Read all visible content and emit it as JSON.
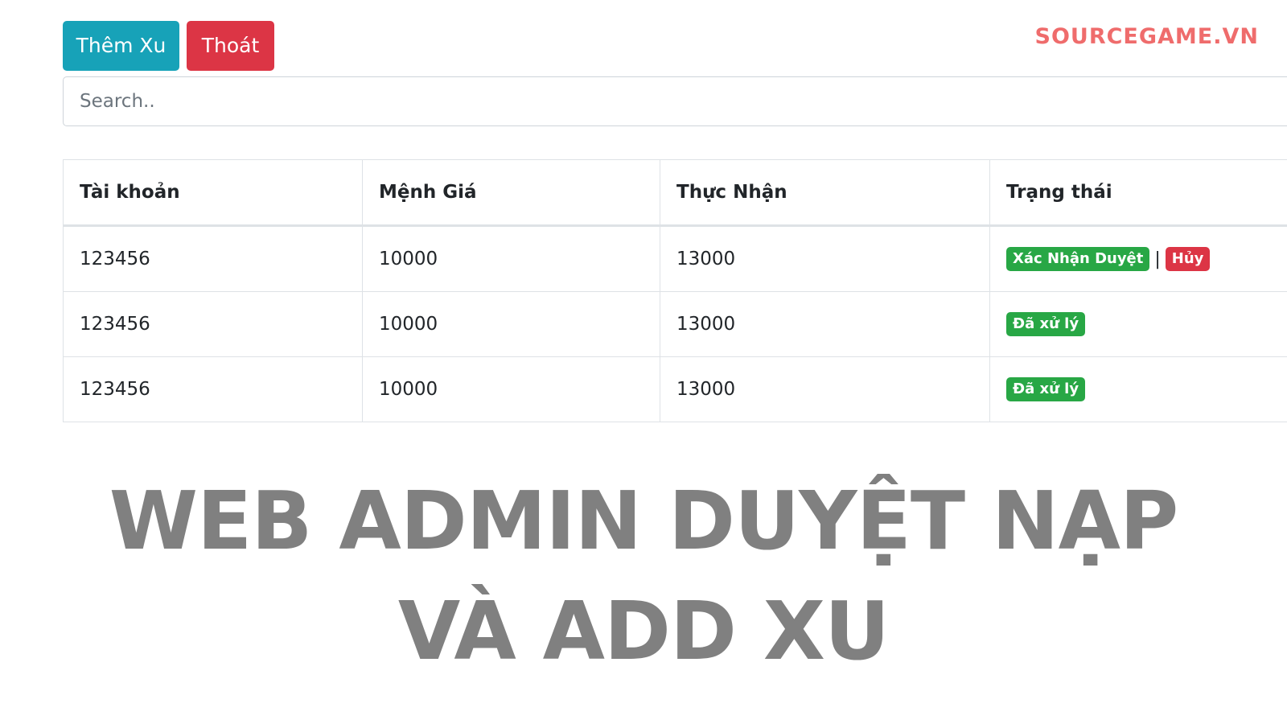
{
  "toolbar": {
    "add_label": "Thêm Xu",
    "exit_label": "Thoát"
  },
  "brand": "SOURCEGAME.VN",
  "search": {
    "placeholder": "Search.."
  },
  "table": {
    "headers": [
      "Tài khoản",
      "Mệnh Giá",
      "Thực Nhận",
      "Trạng thái"
    ],
    "rows": [
      {
        "account": "123456",
        "value": "10000",
        "received": "13000",
        "status": "pending",
        "confirm_label": "Xác Nhận Duyệt",
        "separator": "|",
        "cancel_label": "Hủy"
      },
      {
        "account": "123456",
        "value": "10000",
        "received": "13000",
        "status": "done",
        "status_label": "Đã xử lý"
      },
      {
        "account": "123456",
        "value": "10000",
        "received": "13000",
        "status": "done",
        "status_label": "Đã xử lý"
      }
    ]
  },
  "overlay": {
    "line1": "WEB ADMIN DUYỆT NẠP",
    "line2": "VÀ ADD XU"
  },
  "colors": {
    "info": "#17a2b8",
    "danger": "#dc3545",
    "success": "#28a745",
    "brand": "#ef6c6c",
    "overlay_text": "#808080"
  }
}
